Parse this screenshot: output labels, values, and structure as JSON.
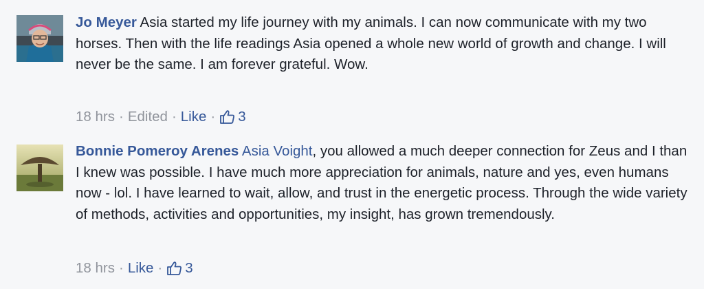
{
  "colors": {
    "background": "#f6f7f9",
    "link": "#365899",
    "text": "#1d2129",
    "meta": "#90949c"
  },
  "comments": [
    {
      "author": "Jo Meyer",
      "text": "Asia started my life journey with my animals. I can now communicate with my two horses. Then with the life readings Asia opened a whole new world of growth and change. I will never be the same. I am forever grateful. Wow.",
      "time": "18 hrs",
      "edited": "Edited",
      "like_label": "Like",
      "reaction_icon": "thumbs-up-icon",
      "reaction_count": "3"
    },
    {
      "author": "Bonnie Pomeroy Arenes",
      "mention": "Asia Voight",
      "text": ", you allowed a much deeper connection for Zeus and I than I knew was possible. I have much more appreciation for animals, nature and yes, even humans now - lol. I have learned to wait, allow, and trust in the energetic process. Through the wide variety of methods, activities and opportunities, my insight, has grown tremendously.",
      "time": "18 hrs",
      "like_label": "Like",
      "reaction_icon": "thumbs-up-icon",
      "reaction_count": "3"
    }
  ],
  "separator": "·"
}
